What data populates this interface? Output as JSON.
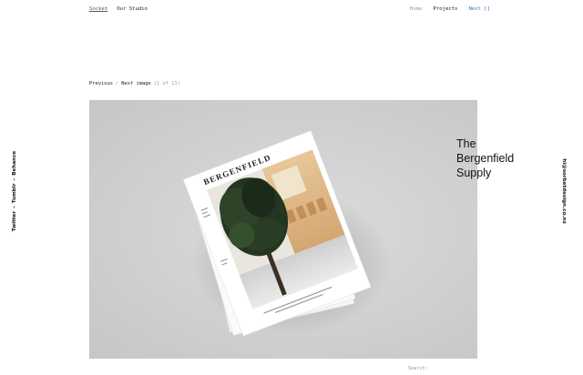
{
  "header": {
    "left_links": [
      "Socket",
      "Our Studio"
    ],
    "right_links": {
      "home": "Home",
      "projects": "Projects",
      "next": "Next []"
    }
  },
  "pager": {
    "previous": "Previous",
    "separator": "/",
    "next": "Next image",
    "count": "(1 of 11)"
  },
  "project": {
    "title_lines": [
      "The",
      "Bergenfield",
      "Supply"
    ],
    "magazine_masthead": "BERGENFIELD"
  },
  "sidebar": {
    "social": [
      "Twitter",
      "Tumblr",
      "Behance"
    ],
    "social_separator": "–",
    "email": "hi@sorbetdesign.co.nz"
  },
  "footer": {
    "search_label": "Search:"
  },
  "colors": {
    "accent_link": "#3b74c9",
    "hero_background": "#cfcfcf"
  }
}
